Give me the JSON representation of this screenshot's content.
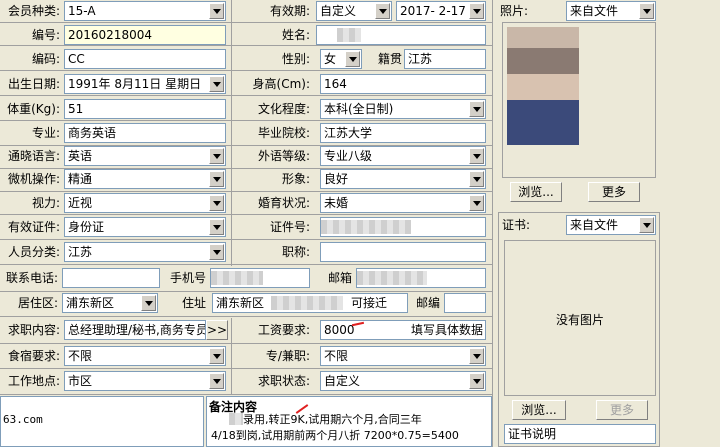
{
  "row1": {
    "member_type_label": "会员种类:",
    "member_type": "15-A",
    "validity_label": "有效期:",
    "validity_mode": "自定义",
    "validity_date": "2017- 2-17"
  },
  "row2": {
    "number_label": "编号:",
    "number": "20160218004",
    "name_label": "姓名:"
  },
  "row3": {
    "code_label": "编码:",
    "code": "CC",
    "gender_label": "性别:",
    "gender": "女",
    "origin_label": "籍贯",
    "origin": "江苏"
  },
  "row4": {
    "birthdate_label": "出生日期:",
    "birthdate": "1991年 8月11日 星期日",
    "height_label": "身高(Cm):",
    "height": "164"
  },
  "row5": {
    "weight_label": "体重(Kg):",
    "weight": "51",
    "education_label": "文化程度:",
    "education": "本科(全日制)"
  },
  "row6": {
    "major_label": "专业:",
    "major": "商务英语",
    "school_label": "毕业院校:",
    "school": "江苏大学"
  },
  "row7": {
    "language_label": "通晓语言:",
    "language": "英语",
    "foreign_level_label": "外语等级:",
    "foreign_level": "专业八级"
  },
  "row8": {
    "computer_label": "微机操作:",
    "computer": "精通",
    "image_label": "形象:",
    "image": "良好"
  },
  "row9": {
    "vision_label": "视力:",
    "vision": "近视",
    "marital_label": "婚育状况:",
    "marital": "未婚"
  },
  "row10": {
    "id_type_label": "有效证件:",
    "id_type": "身份证",
    "id_no_label": "证件号:"
  },
  "row11": {
    "category_label": "人员分类:",
    "category": "江苏",
    "title_label": "职称:"
  },
  "contact": {
    "phone_label": "联系电话:",
    "mobile_label": "手机号",
    "email_label": "邮箱"
  },
  "residence": {
    "area_label": "居住区:",
    "area": "浦东新区",
    "address_label": "住址",
    "address": "浦东新区",
    "address_note": "可接迁",
    "postcode_label": "邮编"
  },
  "job": {
    "intent_label": "求职内容:",
    "intent": "总经理助理/秘书,商务专员",
    "more_button": ">>",
    "salary_label": "工资要求:",
    "salary": "8000",
    "salary_note": "填写具体数据"
  },
  "job2": {
    "lodging_label": "食宿要求:",
    "lodging": "不限",
    "fulltime_label": "专/兼职:",
    "fulltime": "不限"
  },
  "job3": {
    "location_label": "工作地点:",
    "location": "市区",
    "status_label": "求职状态:",
    "status": "自定义"
  },
  "bottom": {
    "email_partial": "63.com",
    "remark_title": "备注内容",
    "remark_line1": "录用,转正9K,试用期六个月,合同三年",
    "remark_line2": "4/18到岗,试用期前两个月八折 7200*0.75=5400"
  },
  "photo": {
    "label": "照片:",
    "source": "来自文件",
    "browse": "浏览...",
    "more": "更多"
  },
  "cert": {
    "label": "证书:",
    "source": "来自文件",
    "no_image": "没有图片",
    "browse": "浏览...",
    "more": "更多",
    "desc_label": "证书说明"
  },
  "colors": {
    "bg": "#ece9d8",
    "input_border": "#7f9db9",
    "highlight": "#ffffe1",
    "mark": "#e02020"
  }
}
